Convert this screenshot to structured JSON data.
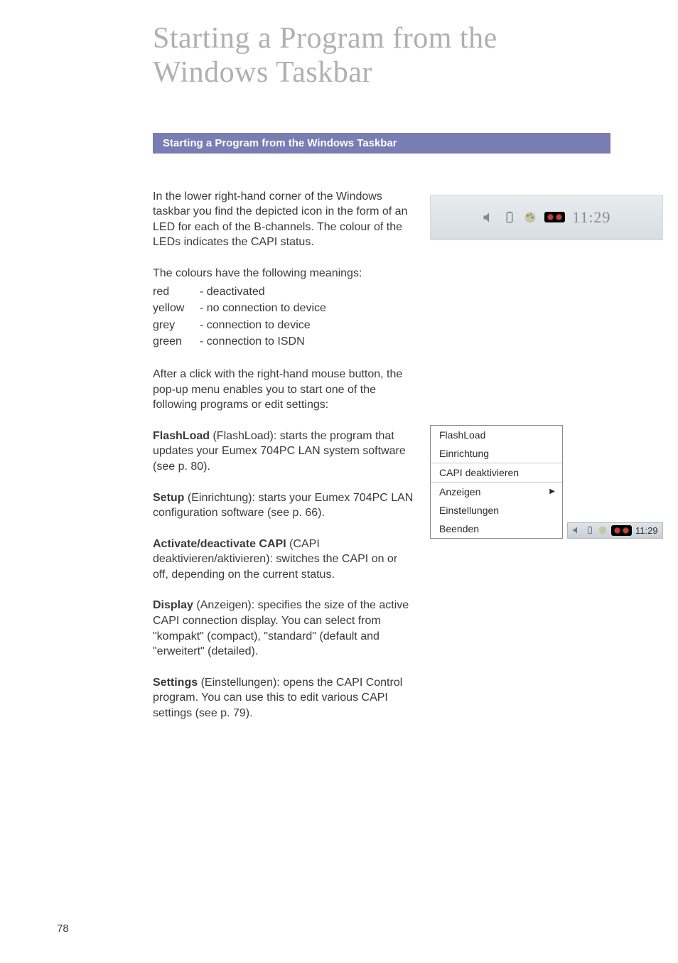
{
  "title": "Starting a Program from the Windows Taskbar",
  "section_bar": "Starting a Program from the Windows Taskbar",
  "intro": "In the lower right-hand corner of the Windows taskbar you find the depicted icon in the form of an LED for each of the B-channels. The colour of the LEDs indicates the CAPI status.",
  "led_intro": "The colours have the following meanings:",
  "led_meanings": [
    {
      "color": "red",
      "meaning": "- deactivated"
    },
    {
      "color": "yellow",
      "meaning": "- no connection to device"
    },
    {
      "color": "grey",
      "meaning": "- connection to device"
    },
    {
      "color": "green",
      "meaning": "- connection to ISDN"
    }
  ],
  "after_click": "After a click with the right-hand mouse button, the pop-up menu enables you to start one of the following programs or edit settings:",
  "items": {
    "flashload": {
      "term": "FlashLoad",
      "rest": " (FlashLoad): starts the program that updates your Eumex 704PC LAN system software (see p. 80)."
    },
    "setup": {
      "term": "Setup",
      "rest": " (Einrichtung): starts your Eumex 704PC LAN configuration software (see p. 66)."
    },
    "capi": {
      "term": "Activate/deactivate CAPI",
      "rest": " (CAPI deaktivieren/aktivieren): switches the CAPI on or off, depending on the current status."
    },
    "display": {
      "term": "Display",
      "mid1": " (Anzeigen): specifies the size of the active CAPI connection display. You can select from \"kompakt\" (",
      "opt1": "compact)",
      "mid2": ", \"standard\" (",
      "opt2": "default",
      "mid3": " and \"erweitert\" (",
      "opt3": "detailed",
      "mid4": ")."
    },
    "settings": {
      "term": "Settings",
      "rest": " (Einstellungen): opens the CAPI Control program. You can use this to edit various CAPI settings (see p. 79)."
    }
  },
  "tray": {
    "time": "11:29",
    "icons": [
      "volume-icon",
      "battery-icon",
      "palette-icon",
      "led-icon"
    ]
  },
  "menu": {
    "items": [
      "FlashLoad",
      "Einrichtung",
      "CAPI deaktivieren",
      "Anzeigen",
      "Einstellungen",
      "Beenden"
    ],
    "time": "11:29"
  },
  "page_number": "78"
}
